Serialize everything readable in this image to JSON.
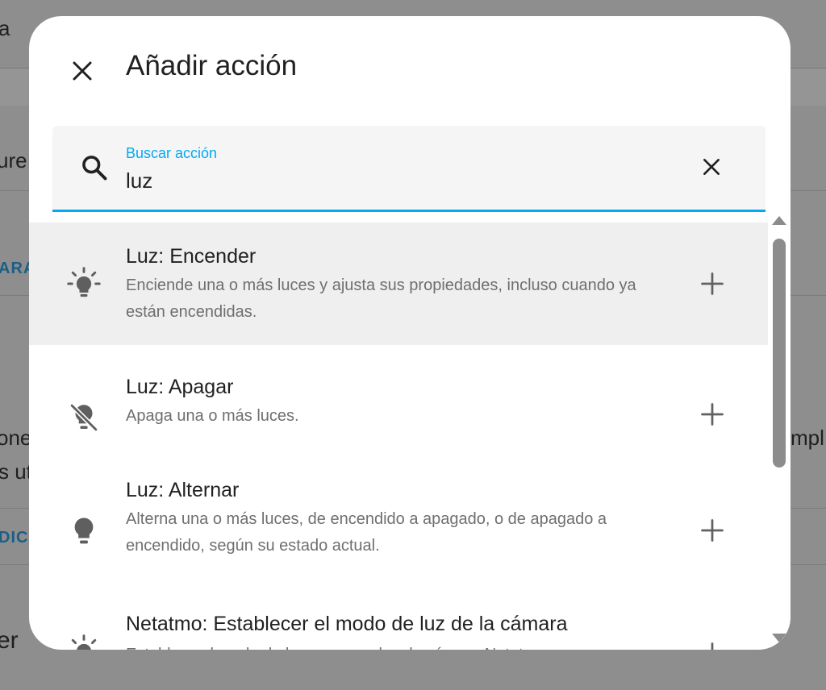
{
  "background": {
    "fragments": [
      "a",
      "ure",
      "ARA",
      "one",
      "s ut",
      "DICI",
      "er",
      "mpl"
    ]
  },
  "dialog": {
    "title": "Añadir acción",
    "close_icon": "close-icon"
  },
  "search": {
    "label": "Buscar acción",
    "value": "luz",
    "icon": "search-icon",
    "clear_icon": "clear-icon",
    "accent_color": "#03a9f4"
  },
  "actions": [
    {
      "icon": "lightbulb-on-icon",
      "title": "Luz: Encender",
      "description": "Enciende una o más luces y ajusta sus propiedades, incluso cuando ya están encendidas.",
      "highlighted": true
    },
    {
      "icon": "lightbulb-off-icon",
      "title": "Luz: Apagar",
      "description": "Apaga una o más luces.",
      "highlighted": false
    },
    {
      "icon": "lightbulb-icon",
      "title": "Luz: Alternar",
      "description": "Alterna una o más luces, de encendido a apagado, o de apagado a encendido, según su estado actual.",
      "highlighted": false
    },
    {
      "icon": "camera-light-icon",
      "title": "Netatmo: Establecer el modo de luz de la cámara",
      "description": "Establece el modo de luz para una luz de cámara Netatmo",
      "highlighted": false
    }
  ],
  "add_icon": "plus-icon"
}
